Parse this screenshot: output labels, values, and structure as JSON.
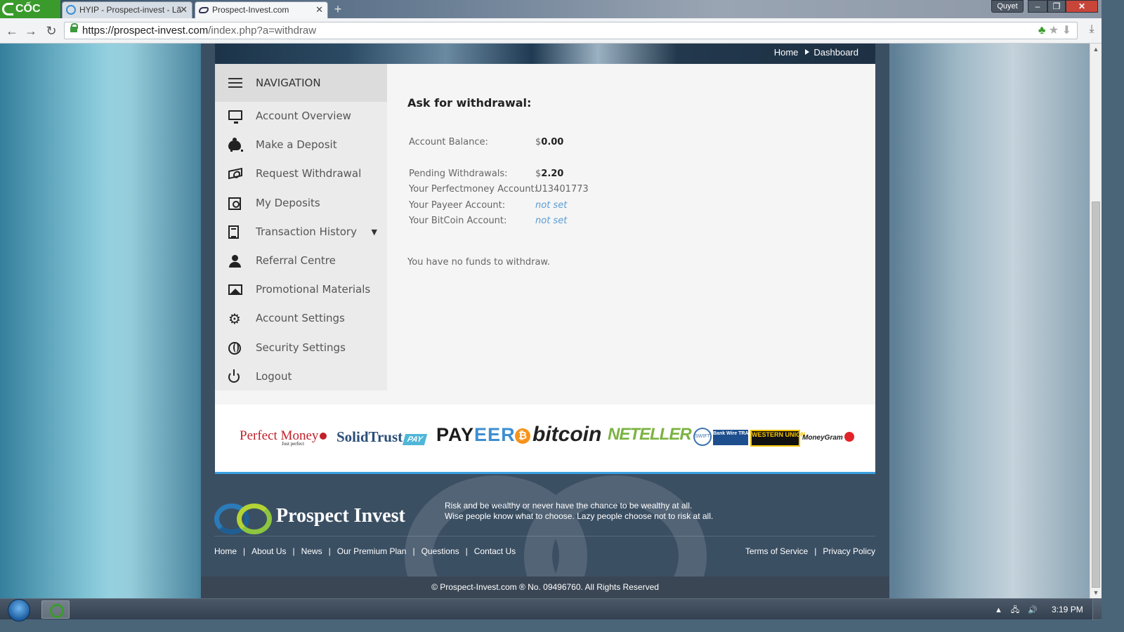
{
  "browser": {
    "logo_text": "CỐC CỐC",
    "tabs": [
      {
        "title": "HYIP - Prospect-invest - Lã",
        "active": false,
        "icon": "skype-icon"
      },
      {
        "title": "Prospect-Invest.com",
        "active": true,
        "icon": "infinity-icon"
      }
    ],
    "user": "Quyet",
    "url_base": "https://prospect-invest.com",
    "url_rest": "/index.php?a=withdraw"
  },
  "breadcrumb": {
    "home": "Home",
    "current": "Dashboard"
  },
  "sidebar": {
    "header": "NAVIGATION",
    "items": [
      {
        "label": "Account Overview",
        "icon": "monitor-icon"
      },
      {
        "label": "Make a Deposit",
        "icon": "piggy-bank-icon"
      },
      {
        "label": "Request Withdrawal",
        "icon": "money-icon"
      },
      {
        "label": "My Deposits",
        "icon": "safe-icon"
      },
      {
        "label": "Transaction History",
        "icon": "document-icon",
        "caret": "▼"
      },
      {
        "label": "Referral Centre",
        "icon": "user-icon"
      },
      {
        "label": "Promotional Materials",
        "icon": "image-icon"
      },
      {
        "label": "Account Settings",
        "icon": "gear-icon"
      },
      {
        "label": "Security Settings",
        "icon": "globe-icon"
      },
      {
        "label": "Logout",
        "icon": "power-icon"
      }
    ]
  },
  "withdraw": {
    "title": "Ask for withdrawal:",
    "balance_label": "Account Balance:",
    "balance_currency": "$",
    "balance_value": "0.00",
    "pending_label": "Pending Withdrawals:",
    "pending_currency": "$",
    "pending_value": "2.20",
    "pm_label": "Your Perfectmoney Account:",
    "pm_value": "U13401773",
    "payeer_label": "Your Payeer Account:",
    "payeer_value": "not set",
    "btc_label": "Your BitCoin Account:",
    "btc_value": "not set",
    "message": "You have no funds to withdraw."
  },
  "payment_logos": {
    "perfect_money": "Perfect Money",
    "perfect_money_sub": "Just perfect",
    "solidtrust": "SolidTrust",
    "solidtrust_pay": "PAY",
    "payeer_a": "PAY",
    "payeer_b": "EER",
    "bitcoin": "bitcoin",
    "bitcoin_symbol": "₿",
    "neteller": "NETELLER",
    "swift": "SWIFT",
    "bankwire": "Bank Wire TRANSFER",
    "western_union": "WESTERN UNION",
    "moneygram": "MoneyGram"
  },
  "footer": {
    "brand": "Prospect Invest",
    "slogan_1": "Risk and be wealthy or never have the chance to be wealthy at all.",
    "slogan_2": "Wise people know what to choose. Lazy people choose not to risk at all.",
    "links": [
      "Home",
      "About Us",
      "News",
      "Our Premium Plan",
      "Questions",
      "Contact Us"
    ],
    "legal": [
      "Terms of Service",
      "Privacy Policy"
    ],
    "copyright": "© Prospect-Invest.com ® No. 09496760. All Rights Reserved"
  },
  "taskbar": {
    "clock": "3:19 PM"
  }
}
